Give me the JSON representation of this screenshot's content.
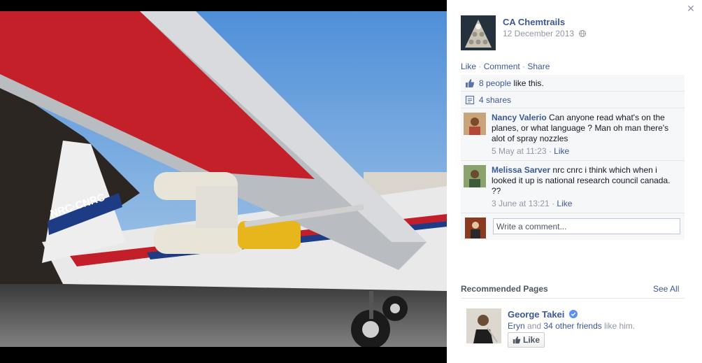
{
  "post": {
    "author": "CA Chemtrails",
    "date": "12 December 2013",
    "privacy_icon": "globe-icon",
    "photo_description_icon": "airplane-photo"
  },
  "actions": {
    "like": "Like",
    "comment": "Comment",
    "share": "Share",
    "separator": " · "
  },
  "ufi": {
    "likes_link": "8 people",
    "likes_suffix": " like this.",
    "shares_link": "4 shares"
  },
  "comments": [
    {
      "name": "Nancy Valerio",
      "text": " Can anyone read what's on the planes, or what language ? Man oh man there's alot of spray nozzles",
      "time": "5 May at 11:23",
      "like": "Like"
    },
    {
      "name": "Melissa Sarver",
      "text": " nrc cnrc i think which when i looked it up is national research council canada. ??",
      "time": "3 June at 13:21",
      "like": "Like"
    }
  ],
  "write_comment": {
    "placeholder": "Write a comment..."
  },
  "recommended": {
    "title": "Recommended Pages",
    "see_all": "See All",
    "page_name": "George Takei",
    "friend_name": "Eryn",
    "and_text": " and ",
    "friends_link": "34 other friends",
    "like_him": " like him.",
    "like_button": "Like"
  },
  "colors": {
    "link": "#3b5998",
    "muted": "#9197a3",
    "ufi_bg": "#f6f7f8"
  }
}
